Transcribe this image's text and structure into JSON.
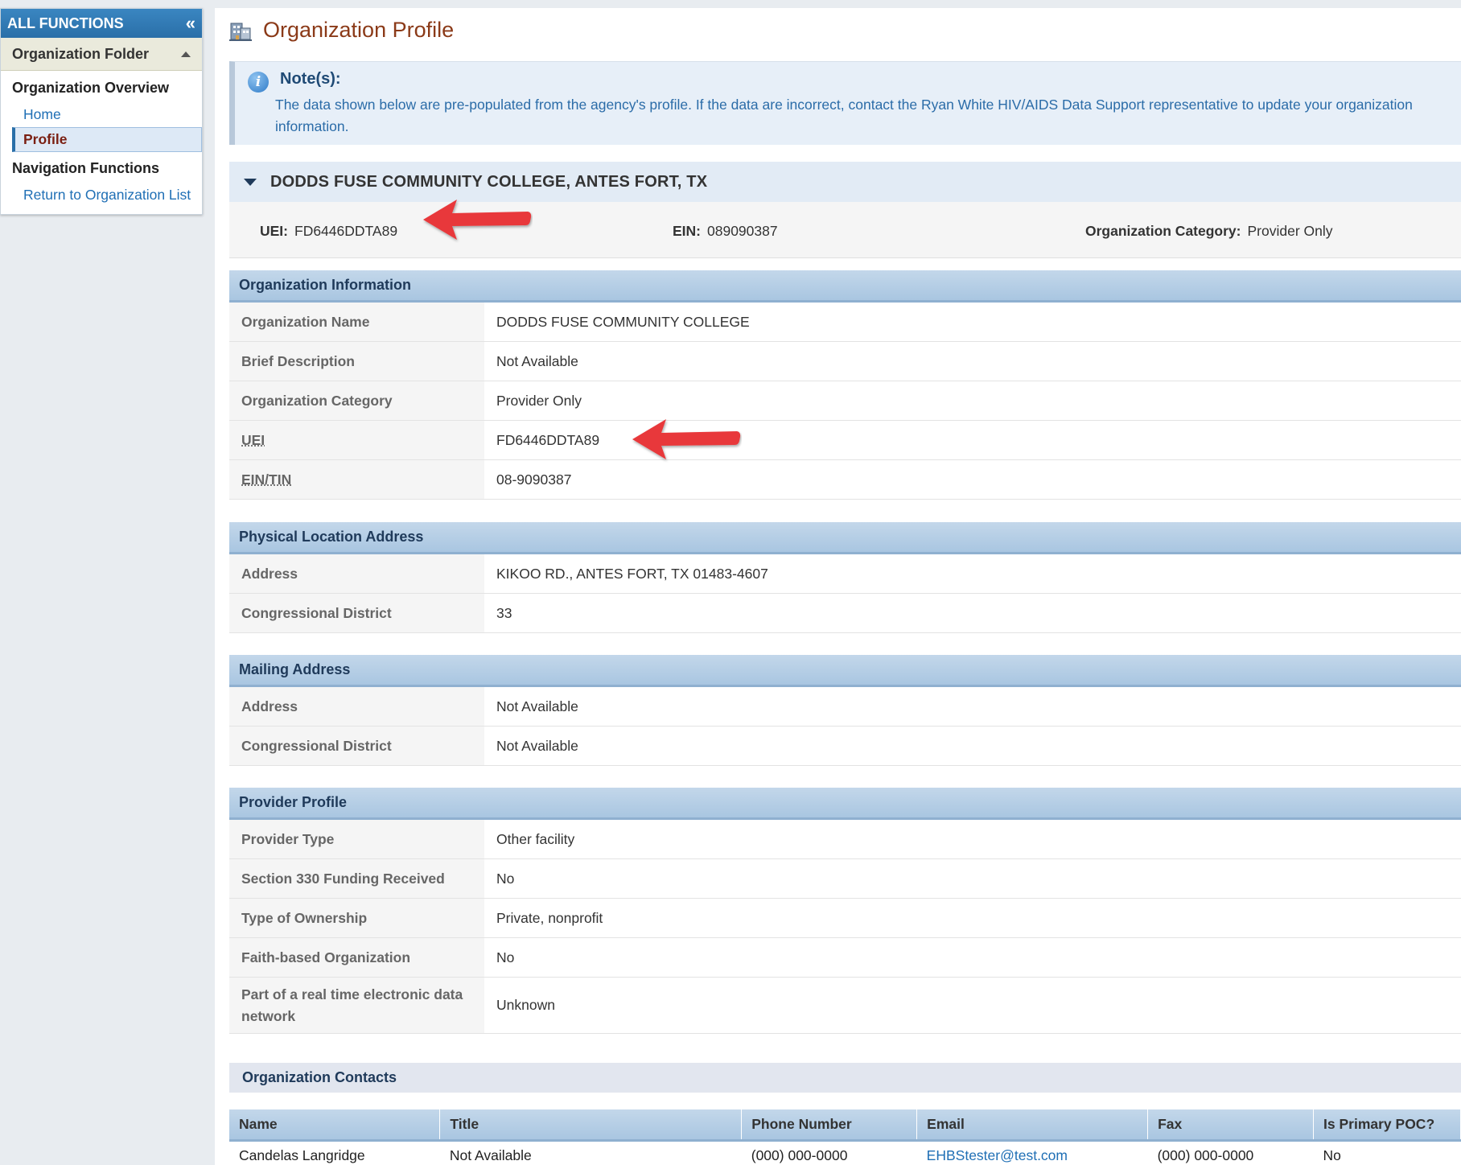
{
  "sidebar": {
    "header": "ALL FUNCTIONS",
    "collapse_glyph": "«",
    "folder": "Organization Folder",
    "sections": [
      {
        "title": "Organization Overview",
        "links": [
          "Home",
          "Profile"
        ]
      },
      {
        "title": "Navigation Functions",
        "links": [
          "Return to Organization List"
        ]
      }
    ]
  },
  "page": {
    "title": "Organization Profile"
  },
  "note": {
    "title": "Note(s):",
    "text": "The data shown below are pre-populated from the agency's profile. If the data are incorrect, contact the Ryan White HIV/AIDS Data Support representative to update your organization information."
  },
  "org_header": {
    "name": "DODDS FUSE COMMUNITY COLLEGE, ANTES FORT, TX",
    "uei_label": "UEI:",
    "uei": "FD6446DDTA89",
    "ein_label": "EIN:",
    "ein": "089090387",
    "category_label": "Organization Category:",
    "category": "Provider Only"
  },
  "org_info": {
    "title": "Organization Information",
    "rows": [
      {
        "label": "Organization Name",
        "value": "DODDS FUSE COMMUNITY COLLEGE"
      },
      {
        "label": "Brief Description",
        "value": "Not Available"
      },
      {
        "label": "Organization Category",
        "value": "Provider Only"
      },
      {
        "label": "UEI",
        "value": "FD6446DDTA89"
      },
      {
        "label": "EIN/TIN",
        "value": "08-9090387"
      }
    ]
  },
  "physical_address": {
    "title": "Physical Location Address",
    "rows": [
      {
        "label": "Address",
        "value": "KIKOO RD., ANTES FORT, TX 01483-4607"
      },
      {
        "label": "Congressional District",
        "value": "33"
      }
    ]
  },
  "mailing_address": {
    "title": "Mailing Address",
    "rows": [
      {
        "label": "Address",
        "value": "Not Available"
      },
      {
        "label": "Congressional District",
        "value": "Not Available"
      }
    ]
  },
  "provider_profile": {
    "title": "Provider Profile",
    "rows": [
      {
        "label": "Provider Type",
        "value": "Other facility"
      },
      {
        "label": "Section 330 Funding Received",
        "value": "No"
      },
      {
        "label": "Type of Ownership",
        "value": "Private, nonprofit"
      },
      {
        "label": "Faith-based Organization",
        "value": "No"
      },
      {
        "label": "Part of a real time electronic data network",
        "value": "Unknown"
      }
    ]
  },
  "contacts": {
    "title": "Organization Contacts",
    "columns": [
      "Name",
      "Title",
      "Phone Number",
      "Email",
      "Fax",
      "Is Primary POC?"
    ],
    "rows": [
      [
        "Candelas Langridge",
        "Not Available",
        "(000) 000-0000",
        "EHBStester@test.com",
        "(000) 000-0000",
        "No"
      ]
    ]
  },
  "colors": {
    "accent": "#2a6fa8",
    "title": "#8b3a18",
    "annotation_arrow": "#e8383a"
  },
  "icons": {
    "collapse": "double-chevron-left-icon",
    "folder_toggle": "triangle-up-icon",
    "info": "info-icon",
    "title": "building-icon",
    "section_toggle": "caret-down-icon"
  }
}
